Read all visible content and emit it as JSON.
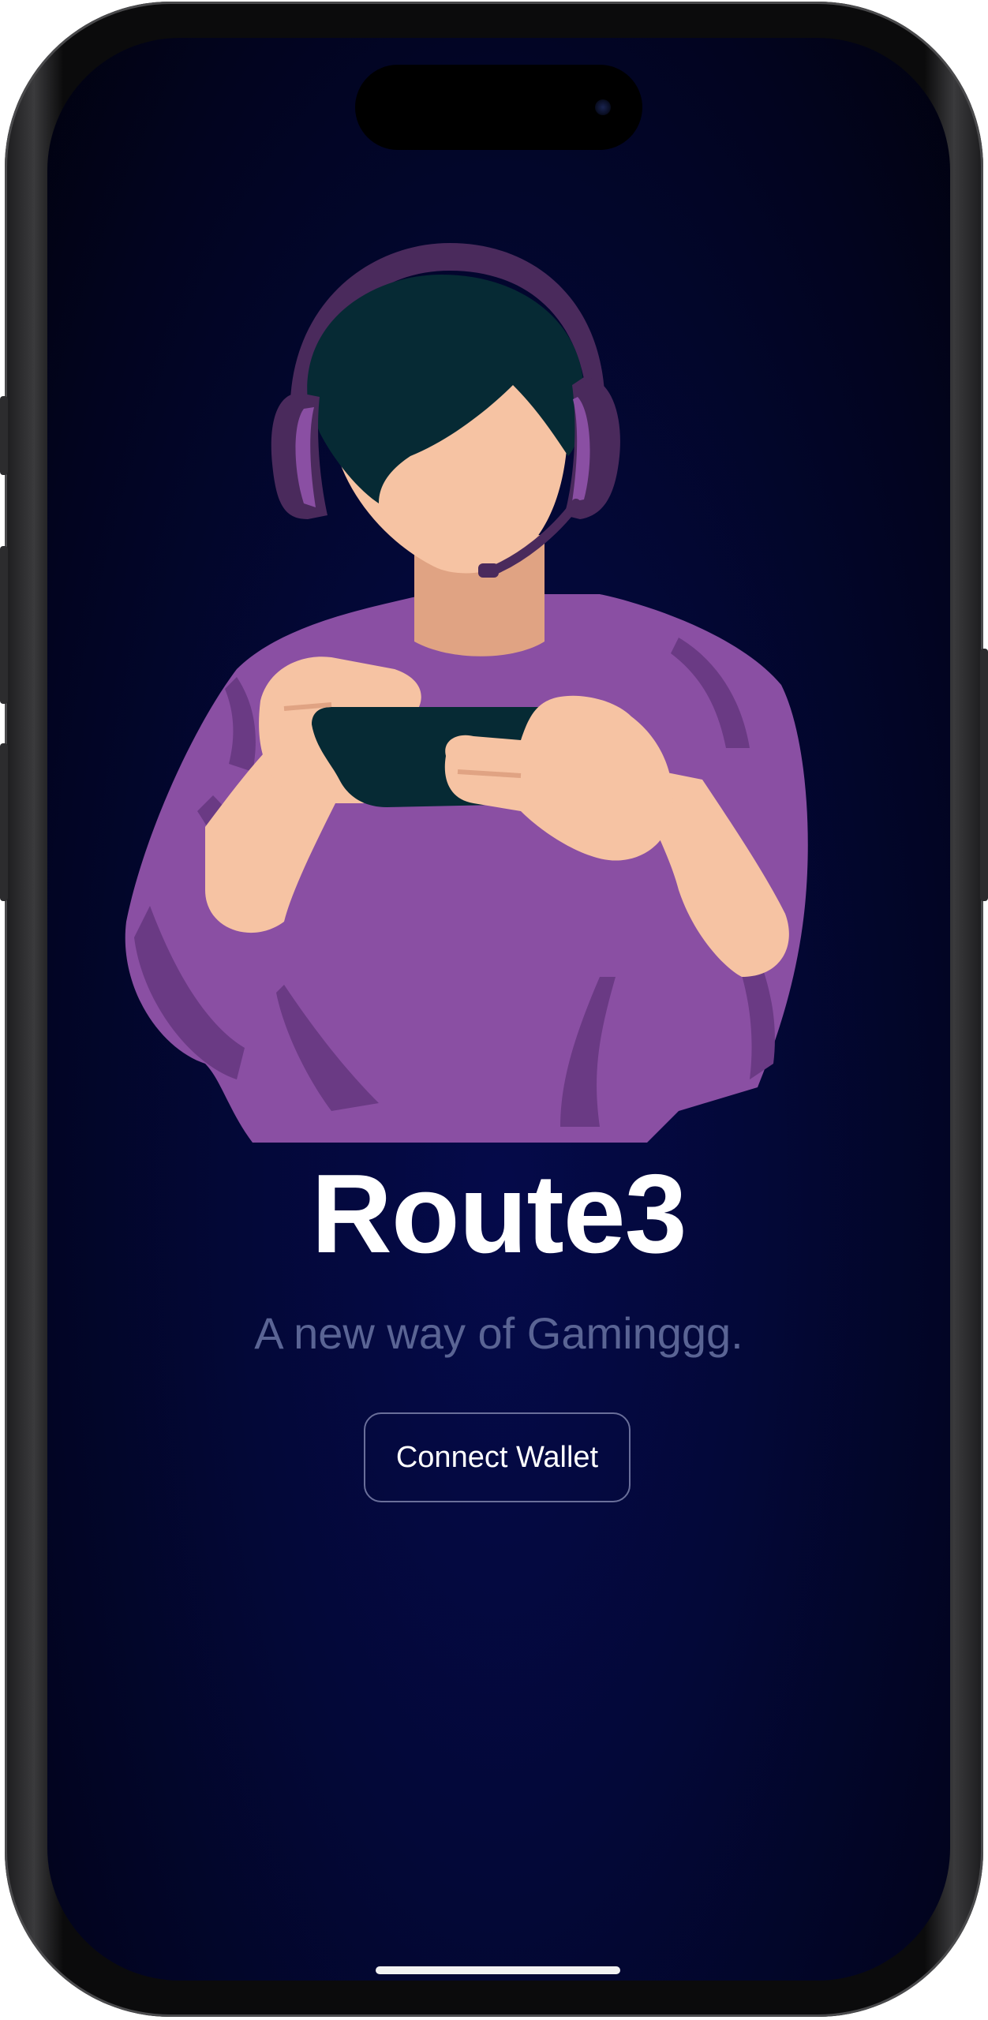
{
  "app": {
    "title": "Route3",
    "subtitle": "A new way of Gaminggg.",
    "connect_button_label": "Connect Wallet"
  },
  "illustration": {
    "subject": "gamer-with-headset-holding-phone",
    "colors": {
      "shirt": "#8a4fa3",
      "shirt_shadow": "#6a3a84",
      "skin": "#f6c3a3",
      "skin_shadow": "#e0a383",
      "hair": "#062a34",
      "headset": "#4a2a5c",
      "headset_accent": "#8a4fa3",
      "phone": "#062a34"
    }
  },
  "theme": {
    "background": "#030838",
    "title_color": "#ffffff",
    "subtitle_color": "#5a6494",
    "button_border": "#6a6f9a"
  }
}
